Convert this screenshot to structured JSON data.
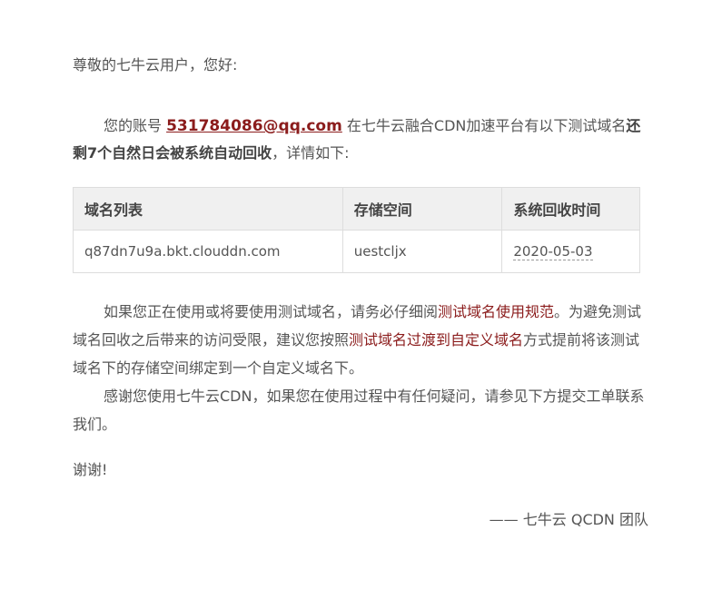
{
  "greeting": "尊敬的七牛云用户，您好:",
  "para1": {
    "prefix": "您的账号 ",
    "email": "531784086@qq.com",
    "middle": " 在七牛云融合CDN加速平台有以下测试域名",
    "bold": "还剩7个自然日会被系统自动回收",
    "suffix": "，详情如下:"
  },
  "table": {
    "headers": [
      "域名列表",
      "存储空间",
      "系统回收时间"
    ],
    "rows": [
      [
        "q87dn7u9a.bkt.clouddn.com",
        "uestcljx",
        "2020-05-03"
      ]
    ]
  },
  "para2": {
    "part1": "如果您正在使用或将要使用测试域名，请务必仔细阅",
    "link1": "测试域名使用规范",
    "part2": "。为避免测试域名回收之后带来的访问受限，建议您按照",
    "link2": "测试域名过渡到自定义域名",
    "part3": "方式提前将该测试域名下的存储空间绑定到一个自定义域名下。"
  },
  "para3": "感谢您使用七牛云CDN，如果您在使用过程中有任何疑问，请参见下方提交工单联系我们。",
  "thanks": "谢谢!",
  "signature": "—— 七牛云 QCDN 团队",
  "colors": {
    "link": "#8b1c1c",
    "text": "#555555",
    "header_bg": "#f0f0f0"
  }
}
